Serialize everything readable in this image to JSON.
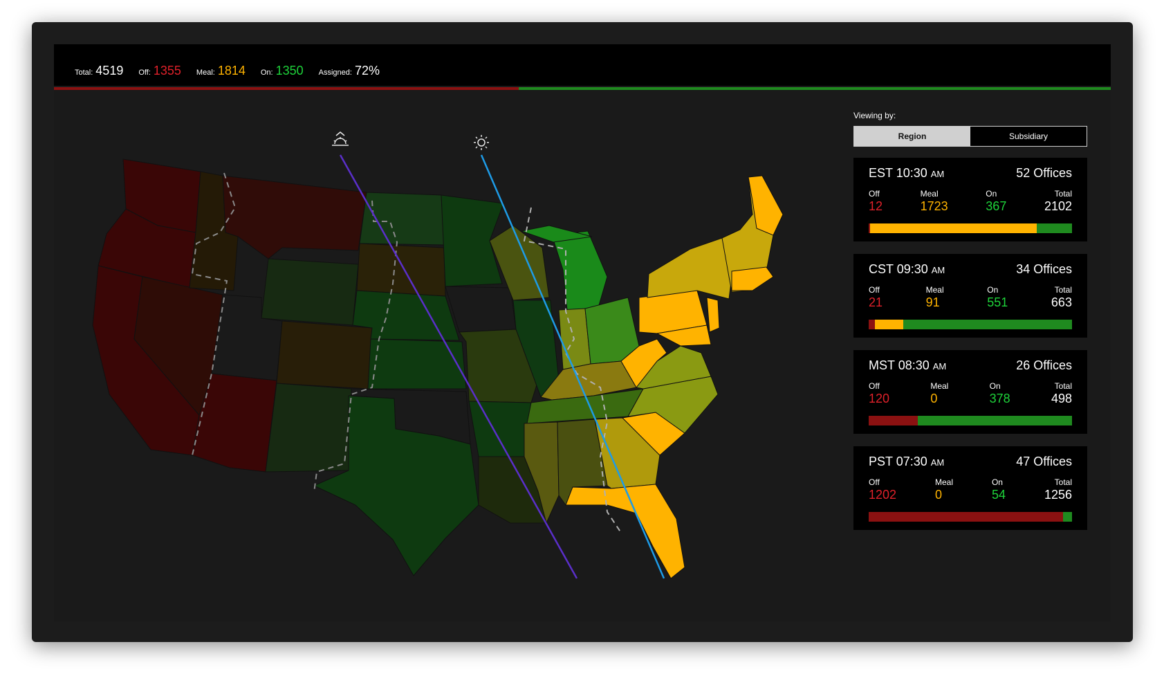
{
  "topbar": {
    "total_label": "Total:",
    "total": "4519",
    "off_label": "Off:",
    "off": "1355",
    "meal_label": "Meal:",
    "meal": "1814",
    "on_label": "On:",
    "on": "1350",
    "assigned_label": "Assigned:",
    "assigned": "72%"
  },
  "colors": {
    "off": "#e0212a",
    "meal": "#ffb300",
    "on": "#1ed33a",
    "bar_off": "#8b1111",
    "bar_meal": "#ffb300",
    "bar_on": "#1f8a1f",
    "sunrise_line": "#5a2fc9",
    "noon_line": "#1e9be6"
  },
  "panel": {
    "viewing_label": "Viewing by:",
    "toggle": [
      "Region",
      "Subsidiary"
    ],
    "selected": "Region"
  },
  "zones": [
    {
      "zone": "EST",
      "time": "10:30",
      "ampm": "AM",
      "offices": "52 Offices",
      "off": "12",
      "meal": "1723",
      "on": "367",
      "total": "2102"
    },
    {
      "zone": "CST",
      "time": "09:30",
      "ampm": "AM",
      "offices": "34 Offices",
      "off": "21",
      "meal": "91",
      "on": "551",
      "total": "663"
    },
    {
      "zone": "MST",
      "time": "08:30",
      "ampm": "AM",
      "offices": "26 Offices",
      "off": "120",
      "meal": "0",
      "on": "378",
      "total": "498"
    },
    {
      "zone": "PST",
      "time": "07:30",
      "ampm": "AM",
      "offices": "47 Offices",
      "off": "1202",
      "meal": "0",
      "on": "54",
      "total": "1256"
    }
  ],
  "metric_labels": {
    "off": "Off",
    "meal": "Meal",
    "on": "On",
    "total": "Total"
  },
  "map": {
    "icons": [
      "sunrise-icon",
      "sun-icon"
    ]
  }
}
